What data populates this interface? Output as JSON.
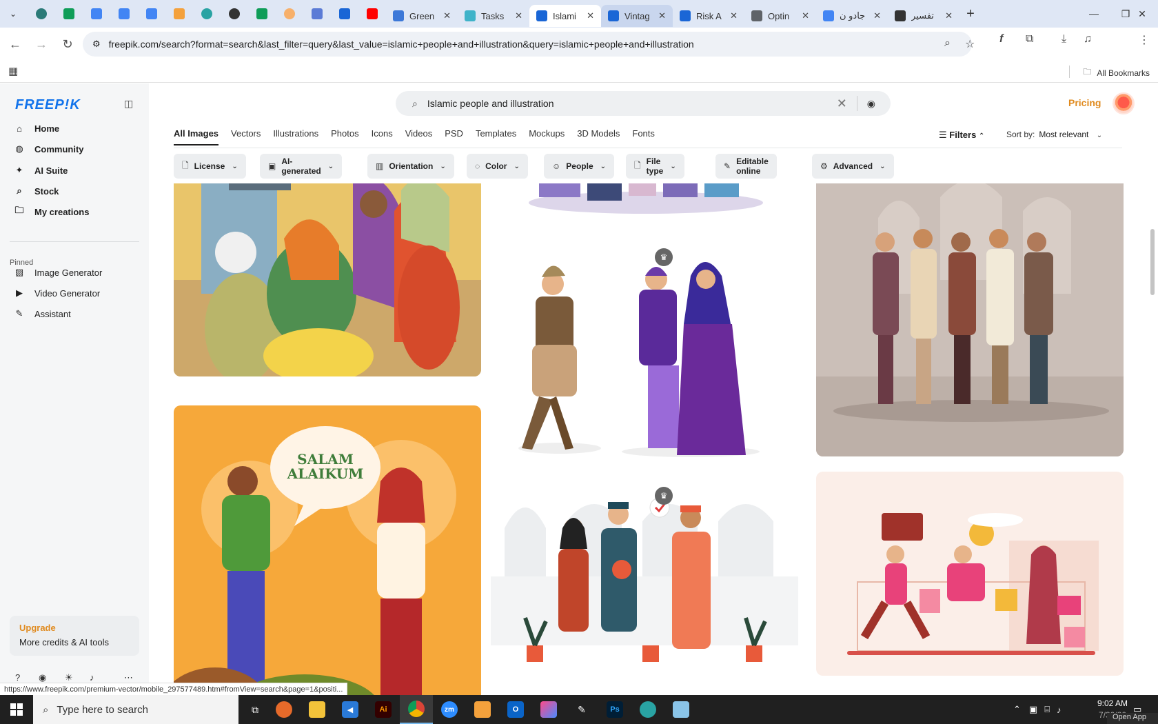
{
  "browser": {
    "tabs": [
      {
        "title": "Green",
        "color": "#3c78d8",
        "state": "normal"
      },
      {
        "title": "Tasks",
        "color": "#3fb3c9",
        "state": "normal"
      },
      {
        "title": "Islami",
        "color": "#1a66d6",
        "state": "active"
      },
      {
        "title": "Vintag",
        "color": "#1a66d6",
        "state": "hover"
      },
      {
        "title": "Risk A",
        "color": "#1a66d6",
        "state": "normal"
      },
      {
        "title": "Optin",
        "color": "#5f6368",
        "state": "normal"
      },
      {
        "title": "جادو ن",
        "color": "#4285f4",
        "state": "normal"
      },
      {
        "title": "تفسير",
        "color": "#333333",
        "state": "normal"
      }
    ],
    "url": "freepik.com/search?format=search&last_filter=query&last_value=islamic+people+and+illustration&query=islamic+people+and+illustration",
    "bookmarks_label": "All Bookmarks",
    "status_url": "https://www.freepik.com/premium-vector/mobile_297577489.htm#fromView=search&page=1&positi..."
  },
  "sidebar": {
    "logo": "FREEP!K",
    "nav": [
      {
        "label": "Home",
        "icon": "home-icon"
      },
      {
        "label": "Community",
        "icon": "globe-icon"
      },
      {
        "label": "AI Suite",
        "icon": "sparkle-icon"
      },
      {
        "label": "Stock",
        "icon": "search-icon"
      },
      {
        "label": "My creations",
        "icon": "folder-icon"
      }
    ],
    "pinned_label": "Pinned",
    "pinned": [
      {
        "label": "Image Generator",
        "icon": "image-icon"
      },
      {
        "label": "Video Generator",
        "icon": "video-icon"
      },
      {
        "label": "Assistant",
        "icon": "assistant-icon"
      }
    ],
    "upgrade": {
      "title": "Upgrade",
      "subtitle": "More credits & AI tools"
    }
  },
  "header": {
    "search_value": "Islamic people and illustration",
    "pricing": "Pricing"
  },
  "category_tabs": [
    "All Images",
    "Vectors",
    "Illustrations",
    "Photos",
    "Icons",
    "Videos",
    "PSD",
    "Templates",
    "Mockups",
    "3D Models",
    "Fonts"
  ],
  "filters_label": "Filters",
  "sort": {
    "label": "Sort by:",
    "value": "Most relevant"
  },
  "chips": [
    {
      "label": "License",
      "icon": "license-icon"
    },
    {
      "label": "AI-generated",
      "icon": "ai-icon"
    },
    {
      "label": "Orientation",
      "icon": "orientation-icon"
    },
    {
      "label": "Color",
      "icon": "color-icon"
    },
    {
      "label": "People",
      "icon": "people-icon"
    },
    {
      "label": "File type",
      "icon": "file-icon"
    },
    {
      "label": "Editable online",
      "icon": "edit-icon"
    },
    {
      "label": "Advanced",
      "icon": "settings-icon"
    }
  ],
  "gallery": {
    "salam_text": "SALAM ALAIKUM"
  },
  "taskbar": {
    "search_placeholder": "Type here to search",
    "time": "9:02 AM",
    "date": "7/30/20",
    "open_app": "Open App"
  }
}
